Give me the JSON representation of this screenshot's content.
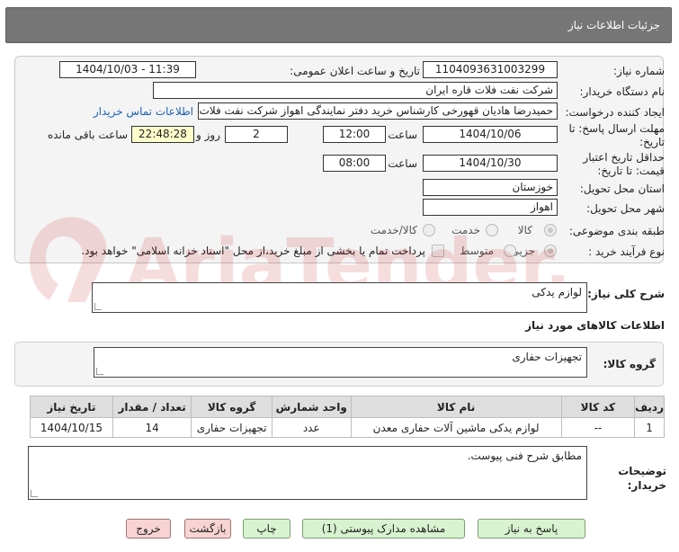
{
  "header": {
    "title": "جزئیات اطلاعات نیاز"
  },
  "form": {
    "need_number_label": "شماره نیاز:",
    "need_number": "1104093631003299",
    "announce_label": "تاریخ و ساعت اعلان عمومی:",
    "announce_value": "1404/10/03 - 11:39",
    "buyer_org_label": "نام دستگاه خریدار:",
    "buyer_org": "شرکت نفت فلات قاره ایران",
    "creator_label": "ایجاد کننده درخواست:",
    "creator": "حمیدرضا هادیان قهورخی کارشناس خرید دفتر نمایندگی اهواز شرکت نفت فلات",
    "contact_link": "اطلاعات تماس خریدار",
    "deadline_label_1": "مهلت ارسال پاسخ: تا",
    "deadline_label_2": "تاریخ:",
    "deadline_date": "1404/10/06",
    "time_label": "ساعت",
    "deadline_time": "12:00",
    "days_value": "2",
    "days_label": "روز و",
    "remaining_time": "22:48:28",
    "remaining_label": "ساعت باقی مانده",
    "min_validity_label_1": "حداقل تاریخ اعتبار",
    "min_validity_label_2": "قیمت: تا تاریخ:",
    "validity_date": "1404/10/30",
    "validity_time_label": "ساعت",
    "validity_time": "08:00",
    "province_label": "استان محل تحویل:",
    "province": "خوزستان",
    "city_label": "شهر محل تحویل:",
    "city": "اهواز",
    "category_label": "طبقه بندی موضوعی:",
    "category_options": [
      "کالا",
      "خدمت",
      "کالا/خدمت"
    ],
    "process_label": "نوع فرآیند خرید :",
    "process_options": [
      "جزیی",
      "متوسط"
    ],
    "payment_note": "پرداخت تمام یا بخشی از مبلغ خرید،از محل \"اسناد خزانه اسلامی\" خواهد بود."
  },
  "summary": {
    "label": "شرح کلی نیاز:",
    "value": "لوازم یدکی"
  },
  "goods_info_title": "اطلاعات کالاهای مورد نیاز",
  "goods_group": {
    "label": "گروه کالا:",
    "value": "تجهیزات حفاری"
  },
  "table": {
    "headers": [
      "ردیف",
      "کد کالا",
      "نام کالا",
      "واحد شمارش",
      "گروه کالا",
      "تعداد / مقدار",
      "تاریخ نیاز"
    ],
    "rows": [
      [
        "1",
        "--",
        "لوازم یدکی ماشین آلات حفاری معدن",
        "عدد",
        "تجهیزات حفاری",
        "14",
        "1404/10/15"
      ]
    ]
  },
  "buyer_notes": {
    "label_1": "توضیحات",
    "label_2": "خریدار:",
    "value": "مطابق شرح فنی پیوست."
  },
  "buttons": {
    "reply": "پاسخ به نیاز",
    "attachments": "مشاهده مدارک پیوستی (1)",
    "print": "چاپ",
    "back": "بازگشت",
    "exit": "خروج"
  },
  "watermark_text": "AriaTender.neT"
}
